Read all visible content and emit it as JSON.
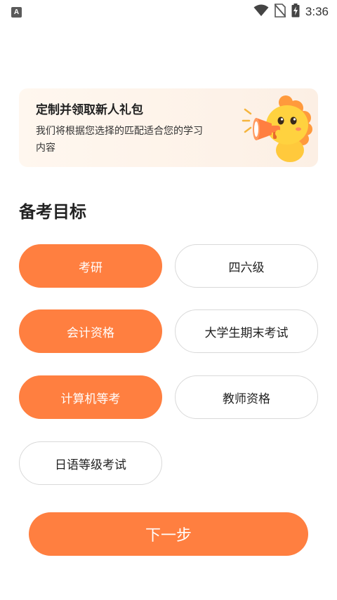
{
  "status_bar": {
    "app_icon_letter": "A",
    "time": "3:36"
  },
  "banner": {
    "title": "定制并领取新人礼包",
    "description": "我们将根据您选择的匹配适合您的学习内容"
  },
  "section": {
    "title": "备考目标"
  },
  "options": [
    {
      "label": "考研",
      "selected": true
    },
    {
      "label": "四六级",
      "selected": false
    },
    {
      "label": "会计资格",
      "selected": true
    },
    {
      "label": "大学生期末考试",
      "selected": false
    },
    {
      "label": "计算机等考",
      "selected": true
    },
    {
      "label": "教师资格",
      "selected": false
    },
    {
      "label": "日语等级考试",
      "selected": false
    }
  ],
  "next_button": {
    "label": "下一步"
  },
  "colors": {
    "accent": "#ff7f40",
    "unselected_border": "#d9d9d9",
    "banner_bg": "#fff7ef"
  }
}
